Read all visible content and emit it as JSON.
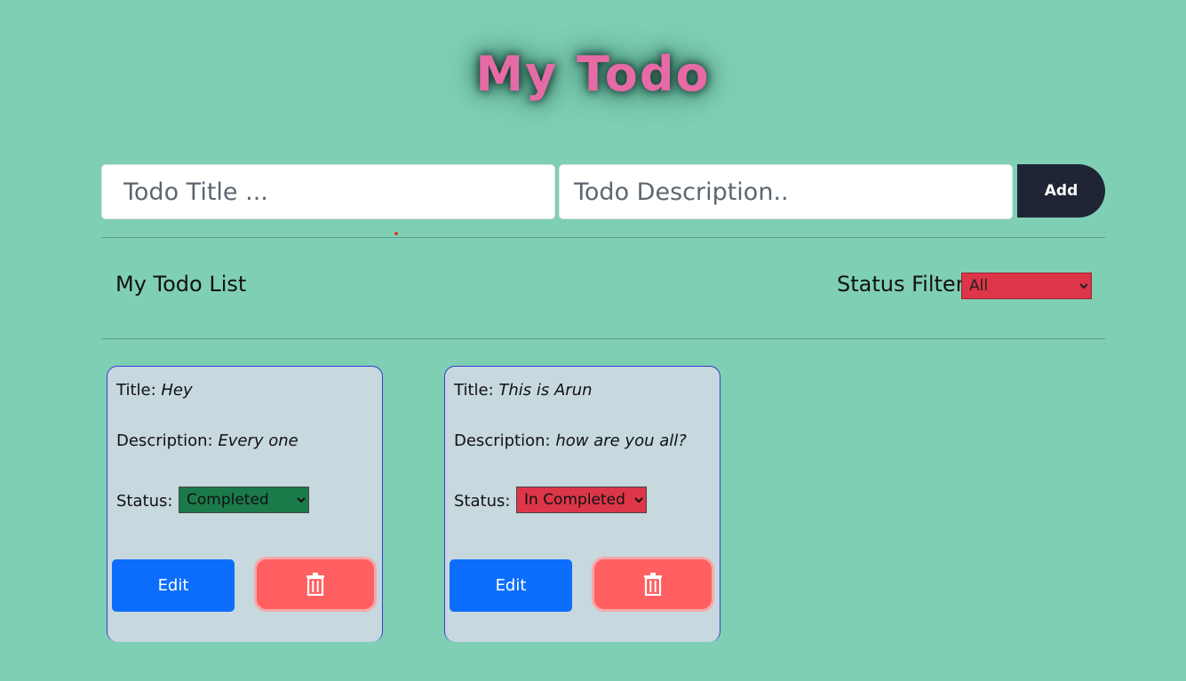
{
  "app": {
    "title": "My Todo"
  },
  "form": {
    "title_placeholder": "Todo Title ...",
    "description_placeholder": "Todo Description..",
    "add_label": "Add"
  },
  "list": {
    "heading": "My Todo List",
    "filter_label": "Status Filter:",
    "filter_value": "All"
  },
  "todos": [
    {
      "title_label": "Title:",
      "title": "Hey",
      "description_label": "Description:",
      "description": "Every one",
      "status_label": "Status:",
      "status": "Completed",
      "status_color": "#1b7a4a",
      "edit_label": "Edit",
      "delete_icon": "trash-icon"
    },
    {
      "title_label": "Title:",
      "title": "This is Arun",
      "description_label": "Description:",
      "description": "how are you all?",
      "status_label": "Status:",
      "status": "In Completed",
      "status_color": "#dc3648",
      "edit_label": "Edit",
      "delete_icon": "trash-icon"
    }
  ],
  "colors": {
    "background": "#7fcfb5",
    "title_pink": "#e56aa5",
    "add_button": "#1f2535",
    "card": "#c7d8de",
    "edit_button": "#0d6efd",
    "delete_button": "#ff5f61"
  }
}
